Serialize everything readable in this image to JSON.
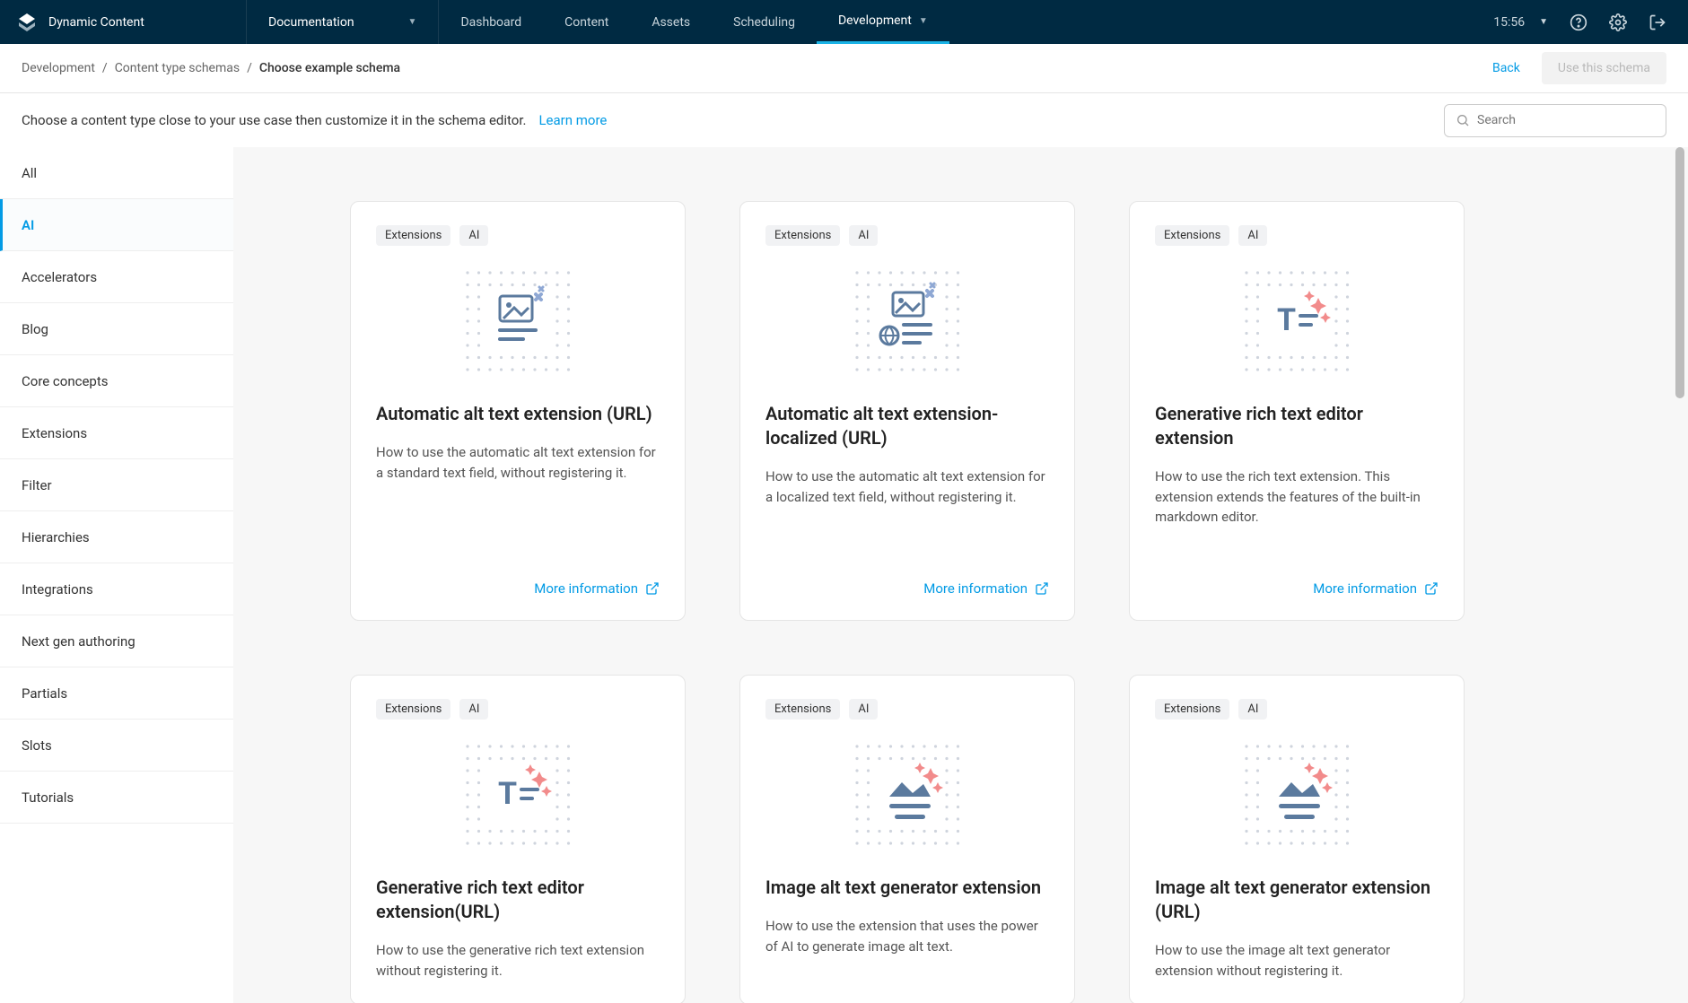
{
  "brand": "Dynamic Content",
  "doc_label": "Documentation",
  "nav": {
    "dashboard": "Dashboard",
    "content": "Content",
    "assets": "Assets",
    "scheduling": "Scheduling",
    "development": "Development"
  },
  "time": "15:56",
  "breadcrumb": {
    "dev": "Development",
    "cts": "Content type schemas",
    "current": "Choose example schema"
  },
  "back": "Back",
  "use_schema": "Use this schema",
  "description": "Choose a content type close to your use case then customize it in the schema editor.",
  "learn": "Learn more",
  "search_placeholder": "Search",
  "sidebar": [
    "All",
    "AI",
    "Accelerators",
    "Blog",
    "Core concepts",
    "Extensions",
    "Filter",
    "Hierarchies",
    "Integrations",
    "Next gen authoring",
    "Partials",
    "Slots",
    "Tutorials"
  ],
  "sidebar_active": 1,
  "pill_ext": "Extensions",
  "pill_ai": "AI",
  "more_info": "More information",
  "cards": [
    {
      "title": "Automatic alt text extension (URL)",
      "desc": "How to use the automatic alt text extension for a standard text field, without registering it.",
      "icon": "alt-url"
    },
    {
      "title": "Automatic alt text extension- localized (URL)",
      "desc": "How to use the automatic alt text extension for a localized text field, without registering it.",
      "icon": "alt-local"
    },
    {
      "title": "Generative rich text editor extension",
      "desc": "How to use the rich text extension. This extension extends the features of the built-in markdown editor.",
      "icon": "gen-rte"
    },
    {
      "title": "Generative rich text editor extension(URL)",
      "desc": "How to use the generative rich text extension without registering it.",
      "icon": "gen-rte"
    },
    {
      "title": "Image alt text generator extension",
      "desc": "How to use the extension that uses the power of AI to generate image alt text.",
      "icon": "img-gen"
    },
    {
      "title": "Image alt text generator extension (URL)",
      "desc": "How to use the image alt text generator extension without registering it.",
      "icon": "img-gen"
    }
  ]
}
